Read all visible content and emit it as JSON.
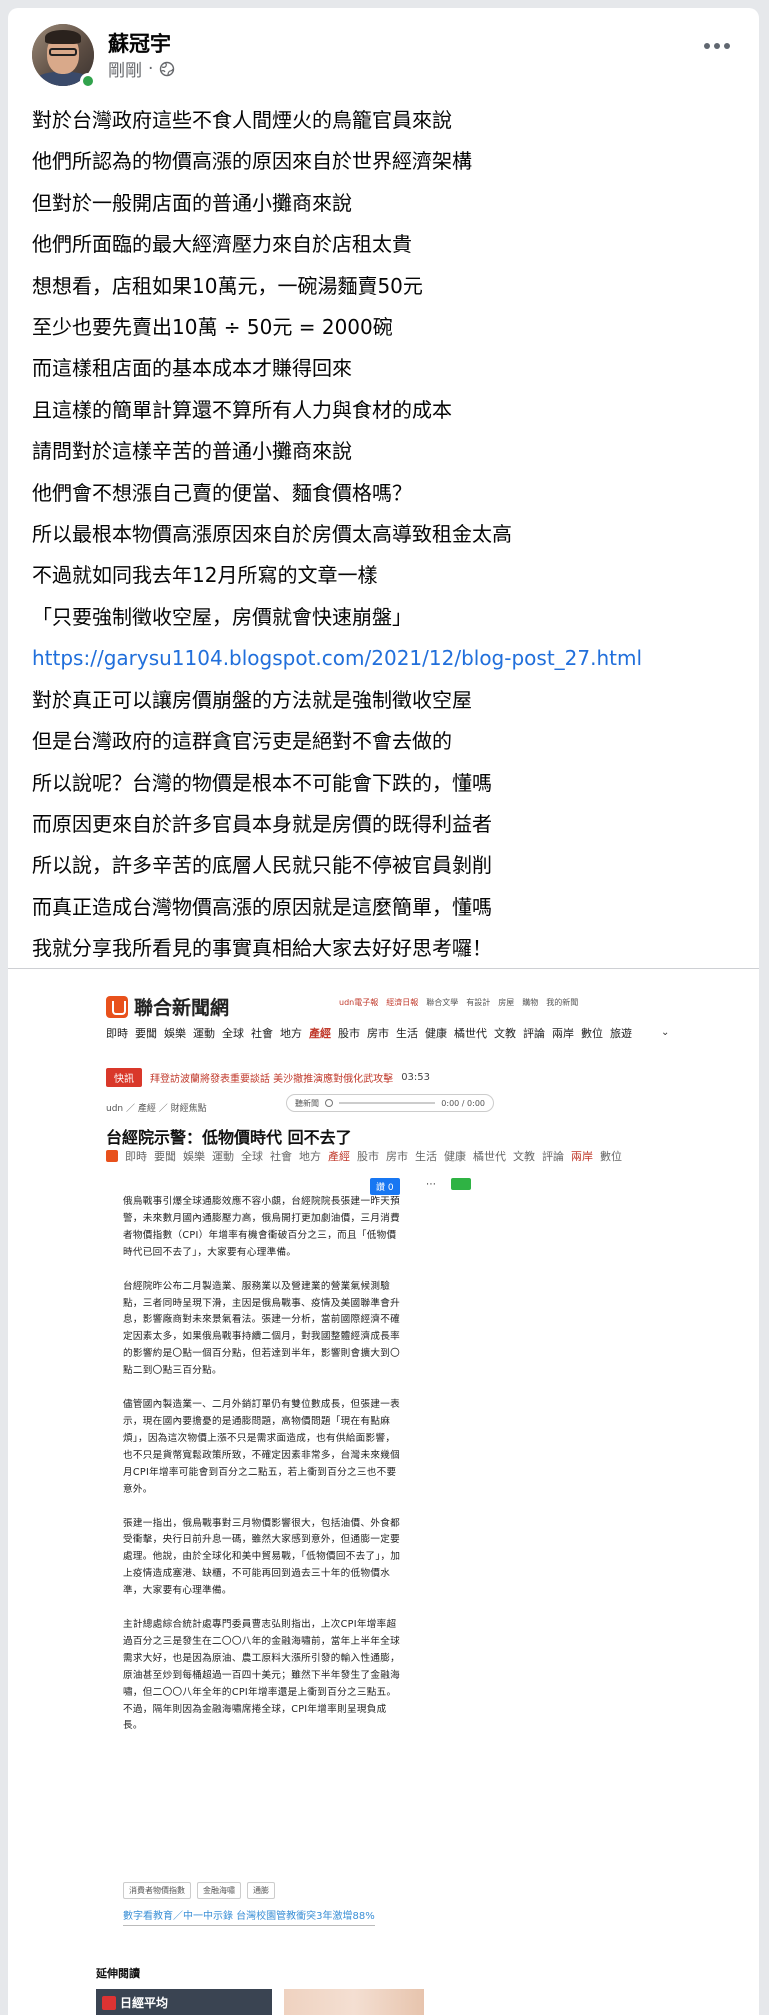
{
  "post": {
    "author": "蘇冠宇",
    "timestamp": "剛剛",
    "separator": "·",
    "privacy_icon": "globe-icon",
    "more_icon": "more-horizontal-icon",
    "lines": [
      "對於台灣政府這些不食人間煙火的鳥籠官員來說",
      "他們所認為的物價高漲的原因來自於世界經濟架構",
      "但對於一般開店面的普通小攤商來說",
      "他們所面臨的最大經濟壓力來自於店租太貴",
      "想想看，店租如果10萬元，一碗湯麵賣50元",
      "至少也要先賣出10萬 ÷ 50元 = 2000碗",
      "而這樣租店面的基本成本才賺得回來",
      "且這樣的簡單計算還不算所有人力與食材的成本",
      "請問對於這樣辛苦的普通小攤商來說",
      "他們會不想漲自己賣的便當、麵食價格嗎？",
      "所以最根本物價高漲原因來自於房價太高導致租金太高",
      "不過就如同我去年12月所寫的文章一樣",
      "「只要強制徵收空屋，房價就會快速崩盤」"
    ],
    "link": "https://garysu1104.blogspot.com/2021/12/blog-post_27.html",
    "lines_after": [
      "對於真正可以讓房價崩盤的方法就是強制徵收空屋",
      "但是台灣政府的這群貪官污吏是絕對不會去做的",
      "所以說呢？台灣的物價是根本不可能會下跌的，懂嗎",
      "而原因更來自於許多官員本身就是房價的既得利益者",
      "所以說，許多辛苦的底層人民就只能不停被官員剝削",
      "而真正造成台灣物價高漲的原因就是這麼簡單，懂嗎",
      "我就分享我所看見的事實真相給大家去好好思考囉！"
    ]
  },
  "article": {
    "site_name": "聯合新聞網",
    "top_links": [
      "udn電子報",
      "經濟日報",
      "聯合文學",
      "有設計",
      "房屋",
      "購物",
      "我的新聞"
    ],
    "nav": [
      "即時",
      "要聞",
      "娛樂",
      "運動",
      "全球",
      "社會",
      "地方",
      "產經",
      "股市",
      "房市",
      "生活",
      "健康",
      "橘世代",
      "文教",
      "評論",
      "兩岸",
      "數位",
      "旅遊"
    ],
    "nav_active": "產經",
    "breaking_tag": "快訊",
    "breaking_text": "拜登訪波蘭將發表重要談話 美沙撤推演應對俄化武攻擊",
    "breaking_time": "03:53",
    "breadcrumb": "udn ／ 產經 ／ 財經焦點",
    "audio_label": "聽新聞",
    "audio_time": "0:00 / 0:00",
    "headline": "台經院示警：低物價時代 回不去了",
    "nav2": [
      "即時",
      "要聞",
      "娛樂",
      "運動",
      "全球",
      "社會",
      "地方",
      "產經",
      "股市",
      "房市",
      "生活",
      "健康",
      "橘世代",
      "文教",
      "評論",
      "兩岸",
      "數位"
    ],
    "like_label": "讚 0",
    "paragraphs": [
      "俄烏戰事引爆全球通膨效應不容小覷，台經院院長張建一昨天預警，未來數月國內通膨壓力高，俄烏開打更加劇油價，三月消費者物價指數（CPI）年增率有機會衝破百分之三，而且「低物價時代已回不去了」，大家要有心理準備。",
      "台經院昨公布二月製造業、服務業以及營建業的營業氣候測驗點，三者同時呈現下滑，主因是俄烏戰事、疫情及美國聯準會升息，影響廠商對未來景氣看法。張建一分析，當前國際經濟不確定因素太多，如果俄烏戰事持續二個月，對我國整體經濟成長率的影響約是〇點一個百分點，但若達到半年，影響則會擴大到〇點二到〇點三百分點。",
      "儘管國內製造業一、二月外銷訂單仍有雙位數成長，但張建一表示，現在國內要擔憂的是通膨問題，高物價問題「現在有點麻煩」，因為這次物價上漲不只是需求面造成，也有供給面影響，也不只是貨幣寬鬆政策所致，不確定因素非常多，台灣未來幾個月CPI年增率可能會到百分之二點五，若上衝到百分之三也不要意外。",
      "張建一指出，俄烏戰事對三月物價影響很大，包括油價、外食都受衝擊，央行日前升息一碼，雖然大家感到意外，但通膨一定要處理。他說，由於全球化和美中貿易戰，「低物價回不去了」，加上疫情造成塞港、缺櫃，不可能再回到過去三十年的低物價水準，大家要有心理準備。",
      "主計總處綜合統計處專門委員曹志弘則指出，上次CPI年增率超過百分之三是發生在二〇〇八年的金融海嘯前，當年上半年全球需求大好，也是因為原油、農工原料大漲所引發的輸入性通膨，原油甚至炒到每桶超過一百四十美元；雖然下半年發生了金融海嘯，但二〇〇八年全年的CPI年增率還是上衝到百分之三點五。不過，隔年則因為金融海嘯席捲全球，CPI年增率則呈現負成長。"
    ],
    "tags": [
      "消費者物價指數",
      "金融海嘯",
      "通膨"
    ],
    "promo": "數字看教育／中一中示錄 台灣校園管教衝突3年激增88%",
    "related_title": "延伸閱讀",
    "thumb1_label": "日經平均"
  },
  "colors": {
    "link": "#216fdb",
    "udn_orange": "#e8511c",
    "breaking_red": "#d9382a",
    "online_green": "#31a24c"
  }
}
